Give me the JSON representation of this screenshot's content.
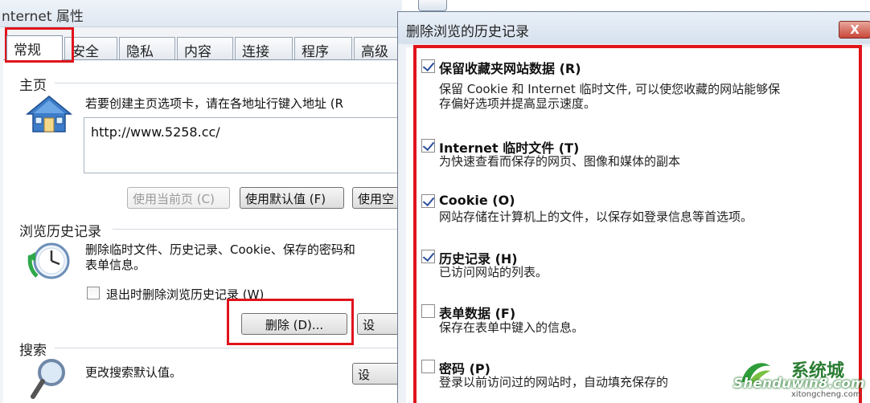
{
  "left_window": {
    "title": "nternet 属性",
    "tabs": [
      "常规",
      "安全",
      "隐私",
      "内容",
      "连接",
      "程序",
      "高级"
    ],
    "home": {
      "group_label": "主页",
      "description": "若要创建主页选项卡，请在各地址行键入地址 (R",
      "url_value": "http://www.5258.cc/",
      "buttons": [
        "使用当前页 (C)",
        "使用默认值 (F)",
        "使用空"
      ]
    },
    "history": {
      "group_label": "浏览历史记录",
      "description_line1": "删除临时文件、历史记录、Cookie、保存的密码和",
      "description_line2": "表单信息。",
      "checkbox_label": "退出时删除浏览历史记录 (W)",
      "delete_button": "删除 (D)...",
      "settings_button": "设"
    },
    "search": {
      "group_label": "搜索",
      "description": "更改搜索默认值。",
      "settings_button": "设"
    }
  },
  "dialog": {
    "title": "删除浏览的历史记录",
    "close_label": "X",
    "options": [
      {
        "title": "保留收藏夹网站数据 (R)",
        "desc": [
          "保留 Cookie 和 Internet 临时文件, 可以使您收藏的网站能够保",
          "存偏好选项并提高显示速度。"
        ],
        "checked": true
      },
      {
        "title": "Internet 临时文件 (T)",
        "desc": [
          "为快速查看而保存的网页、图像和媒体的副本"
        ],
        "checked": true
      },
      {
        "title": "Cookie (O)",
        "desc": [
          "网站存储在计算机上的文件，以保存如登录信息等首选项。"
        ],
        "checked": true
      },
      {
        "title": "历史记录 (H)",
        "desc": [
          "已访问网站的列表。"
        ],
        "checked": true
      },
      {
        "title": "表单数据 (F)",
        "desc": [
          "保存在表单中键入的信息。"
        ],
        "checked": false
      },
      {
        "title": "密码 (P)",
        "desc": [
          "登录以前访问过的网站时，自动填充保存的"
        ],
        "checked": false
      }
    ]
  },
  "watermark": {
    "brand": "系统城",
    "site": "Shenduwin8.com",
    "domain": "xitongcheng.com"
  },
  "colors": {
    "highlight_red": "#e0141b",
    "check_blue": "#2b4f9c"
  }
}
